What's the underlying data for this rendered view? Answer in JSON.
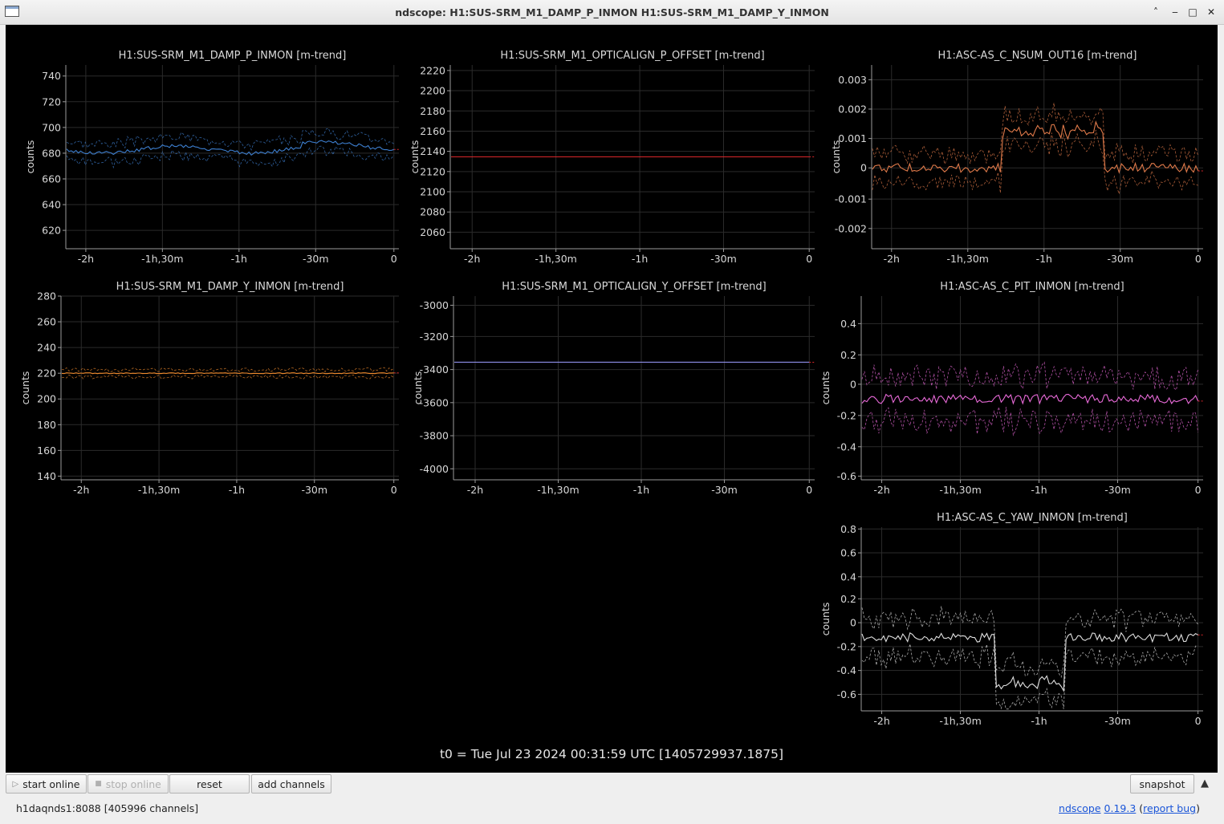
{
  "window": {
    "title": "ndscope: H1:SUS-SRM_M1_DAMP_P_INMON H1:SUS-SRM_M1_DAMP_Y_INMON",
    "controls": [
      "chevron-up-icon",
      "minimize-icon",
      "maximize-icon",
      "close-icon"
    ]
  },
  "plots": [
    {
      "title": "H1:SUS-SRM_M1_DAMP_P_INMON [m-trend]",
      "ylabel": "counts",
      "yticks": [
        "740",
        "720",
        "700",
        "680",
        "660",
        "640",
        "620"
      ],
      "xticks": [
        "-2h",
        "-1h,30m",
        "-1h",
        "-30m",
        "0"
      ],
      "color": "#3d7fd0"
    },
    {
      "title": "H1:SUS-SRM_M1_OPTICALIGN_P_OFFSET [m-trend]",
      "ylabel": "counts",
      "yticks": [
        "2220",
        "2200",
        "2180",
        "2160",
        "2140",
        "2120",
        "2100",
        "2080",
        "2060"
      ],
      "xticks": [
        "-2h",
        "-1h,30m",
        "-1h",
        "-30m",
        "0"
      ],
      "color": "#d8262a"
    },
    {
      "title": "H1:ASC-AS_C_NSUM_OUT16 [m-trend]",
      "ylabel": "counts",
      "yticks": [
        "0.003",
        "0.002",
        "0.001",
        "0",
        "-0.001",
        "-0.002"
      ],
      "xticks": [
        "-2h",
        "-1h,30m",
        "-1h",
        "-30m",
        "0"
      ],
      "color": "#e07a4a"
    },
    {
      "title": "H1:SUS-SRM_M1_DAMP_Y_INMON [m-trend]",
      "ylabel": "counts",
      "yticks": [
        "280",
        "260",
        "240",
        "220",
        "200",
        "180",
        "160",
        "140"
      ],
      "xticks": [
        "-2h",
        "-1h,30m",
        "-1h",
        "-30m",
        "0"
      ],
      "color": "#f08a2c"
    },
    {
      "title": "H1:SUS-SRM_M1_OPTICALIGN_Y_OFFSET [m-trend]",
      "ylabel": "counts",
      "yticks": [
        "-3000",
        "-3200",
        "-3400",
        "-3600",
        "-3800",
        "-4000"
      ],
      "xticks": [
        "-2h",
        "-1h,30m",
        "-1h",
        "-30m",
        "0"
      ],
      "color": "#8f8fe8"
    },
    {
      "title": "H1:ASC-AS_C_PIT_INMON [m-trend]",
      "ylabel": "counts",
      "yticks": [
        "0.4",
        "0.2",
        "0",
        "-0.2",
        "-0.4",
        "-0.6"
      ],
      "xticks": [
        "-2h",
        "-1h,30m",
        "-1h",
        "-30m",
        "0"
      ],
      "color": "#e86ad8"
    },
    {
      "title": "H1:ASC-AS_C_YAW_INMON [m-trend]",
      "ylabel": "counts",
      "yticks": [
        "0.8",
        "0.6",
        "0.4",
        "0.2",
        "0",
        "-0.2",
        "-0.4",
        "-0.6"
      ],
      "xticks": [
        "-2h",
        "-1h,30m",
        "-1h",
        "-30m",
        "0"
      ],
      "color": "#e0e0e0"
    }
  ],
  "t0_label": "t0 = Tue Jul 23 2024 00:31:59 UTC [1405729937.1875]",
  "toolbar": {
    "start_online": "start online",
    "stop_online": "stop online",
    "reset": "reset",
    "add_channels": "add channels",
    "snapshot": "snapshot"
  },
  "status": {
    "server": "h1daqnds1:8088  [405996 channels]",
    "app_link": "ndscope",
    "version": "0.19.3",
    "report_bug": "report bug"
  }
}
